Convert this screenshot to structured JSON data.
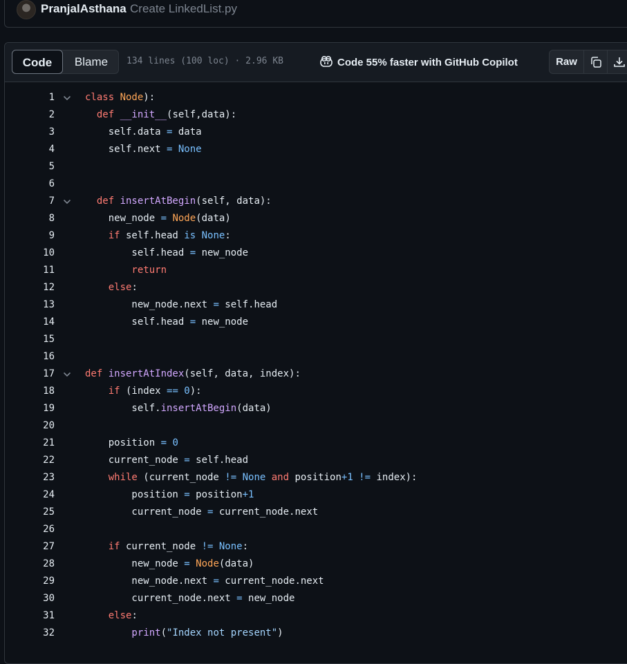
{
  "commit": {
    "author": "PranjalAsthana",
    "message": "Create LinkedList.py"
  },
  "toolbar": {
    "code_tab": "Code",
    "blame_tab": "Blame",
    "file_meta": "134 lines (100 loc) · 2.96 KB",
    "copilot_label": "Code 55% faster with GitHub Copilot",
    "raw_button": "Raw",
    "copy_icon": "copy-icon",
    "download_icon": "download-icon"
  },
  "code_lines": [
    {
      "n": "1",
      "fold": true,
      "tokens": [
        [
          "k",
          "class "
        ],
        [
          "c",
          "Node"
        ],
        [
          "",
          "):"
        ]
      ]
    },
    {
      "n": "2",
      "fold": false,
      "tokens": [
        [
          "",
          "  "
        ],
        [
          "k",
          "def "
        ],
        [
          "f",
          "__init__"
        ],
        [
          "",
          "(self,data):"
        ]
      ]
    },
    {
      "n": "3",
      "fold": false,
      "tokens": [
        [
          "",
          "    self.data "
        ],
        [
          "b",
          "="
        ],
        [
          "",
          " data"
        ]
      ]
    },
    {
      "n": "4",
      "fold": false,
      "tokens": [
        [
          "",
          "    self.next "
        ],
        [
          "b",
          "="
        ],
        [
          "b",
          " None"
        ]
      ]
    },
    {
      "n": "5",
      "fold": false,
      "tokens": []
    },
    {
      "n": "6",
      "fold": false,
      "tokens": []
    },
    {
      "n": "7",
      "fold": true,
      "tokens": [
        [
          "",
          "  "
        ],
        [
          "k",
          "def "
        ],
        [
          "f",
          "insertAtBegin"
        ],
        [
          "",
          "(self, data):"
        ]
      ]
    },
    {
      "n": "8",
      "fold": false,
      "tokens": [
        [
          "",
          "    new_node "
        ],
        [
          "b",
          "="
        ],
        [
          "c",
          " Node"
        ],
        [
          "",
          "(data)"
        ]
      ]
    },
    {
      "n": "9",
      "fold": false,
      "tokens": [
        [
          "k",
          "    if"
        ],
        [
          "",
          " self.head "
        ],
        [
          "b",
          "is None"
        ],
        [
          "",
          ":"
        ]
      ]
    },
    {
      "n": "10",
      "fold": false,
      "tokens": [
        [
          "",
          "        self.head "
        ],
        [
          "b",
          "="
        ],
        [
          "",
          " new_node"
        ]
      ]
    },
    {
      "n": "11",
      "fold": false,
      "tokens": [
        [
          "k",
          "        return"
        ]
      ]
    },
    {
      "n": "12",
      "fold": false,
      "tokens": [
        [
          "k",
          "    else"
        ],
        [
          "",
          ":"
        ]
      ]
    },
    {
      "n": "13",
      "fold": false,
      "tokens": [
        [
          "",
          "        new_node.next "
        ],
        [
          "b",
          "="
        ],
        [
          "",
          " self.head"
        ]
      ]
    },
    {
      "n": "14",
      "fold": false,
      "tokens": [
        [
          "",
          "        self.head "
        ],
        [
          "b",
          "="
        ],
        [
          "",
          " new_node"
        ]
      ]
    },
    {
      "n": "15",
      "fold": false,
      "tokens": []
    },
    {
      "n": "16",
      "fold": false,
      "tokens": []
    },
    {
      "n": "17",
      "fold": true,
      "tokens": [
        [
          "k",
          "def "
        ],
        [
          "f",
          "insertAtIndex"
        ],
        [
          "",
          "(self, data, index):"
        ]
      ]
    },
    {
      "n": "18",
      "fold": false,
      "tokens": [
        [
          "k",
          "    if"
        ],
        [
          "",
          " (index "
        ],
        [
          "b",
          "=="
        ],
        [
          "b",
          " 0"
        ],
        [
          "",
          "):"
        ]
      ]
    },
    {
      "n": "19",
      "fold": false,
      "tokens": [
        [
          "",
          "        self."
        ],
        [
          "f",
          "insertAtBegin"
        ],
        [
          "",
          "(data)"
        ]
      ]
    },
    {
      "n": "20",
      "fold": false,
      "tokens": []
    },
    {
      "n": "21",
      "fold": false,
      "tokens": [
        [
          "",
          "    position "
        ],
        [
          "b",
          "="
        ],
        [
          "b",
          " 0"
        ]
      ]
    },
    {
      "n": "22",
      "fold": false,
      "tokens": [
        [
          "",
          "    current_node "
        ],
        [
          "b",
          "="
        ],
        [
          "",
          " self.head"
        ]
      ]
    },
    {
      "n": "23",
      "fold": false,
      "tokens": [
        [
          "k",
          "    while"
        ],
        [
          "",
          " (current_node "
        ],
        [
          "b",
          "!="
        ],
        [
          "b",
          " None"
        ],
        [
          "k",
          " and"
        ],
        [
          "",
          " position"
        ],
        [
          "b",
          "+1"
        ],
        [
          "b",
          " !="
        ],
        [
          "",
          " index):"
        ]
      ]
    },
    {
      "n": "24",
      "fold": false,
      "tokens": [
        [
          "",
          "        position "
        ],
        [
          "b",
          "="
        ],
        [
          "",
          " position"
        ],
        [
          "b",
          "+1"
        ]
      ]
    },
    {
      "n": "25",
      "fold": false,
      "tokens": [
        [
          "",
          "        current_node "
        ],
        [
          "b",
          "="
        ],
        [
          "",
          " current_node.next"
        ]
      ]
    },
    {
      "n": "26",
      "fold": false,
      "tokens": []
    },
    {
      "n": "27",
      "fold": false,
      "tokens": [
        [
          "k",
          "    if"
        ],
        [
          "",
          " current_node "
        ],
        [
          "b",
          "!="
        ],
        [
          "b",
          " None"
        ],
        [
          "",
          ":"
        ]
      ]
    },
    {
      "n": "28",
      "fold": false,
      "tokens": [
        [
          "",
          "        new_node "
        ],
        [
          "b",
          "="
        ],
        [
          "c",
          " Node"
        ],
        [
          "",
          "(data)"
        ]
      ]
    },
    {
      "n": "29",
      "fold": false,
      "tokens": [
        [
          "",
          "        new_node.next "
        ],
        [
          "b",
          "="
        ],
        [
          "",
          " current_node.next"
        ]
      ]
    },
    {
      "n": "30",
      "fold": false,
      "tokens": [
        [
          "",
          "        current_node.next "
        ],
        [
          "b",
          "="
        ],
        [
          "",
          " new_node"
        ]
      ]
    },
    {
      "n": "31",
      "fold": false,
      "tokens": [
        [
          "k",
          "    else"
        ],
        [
          "",
          ":"
        ]
      ]
    },
    {
      "n": "32",
      "fold": false,
      "tokens": [
        [
          "f",
          "        print"
        ],
        [
          "",
          "("
        ],
        [
          "s",
          "\"Index not present\""
        ],
        [
          "",
          ")"
        ]
      ]
    }
  ],
  "colors": {
    "background": "#0d1117",
    "keyword": "#ff7b72",
    "class_name": "#ffa657",
    "function": "#d2a8ff",
    "constant": "#79c0ff"
  }
}
